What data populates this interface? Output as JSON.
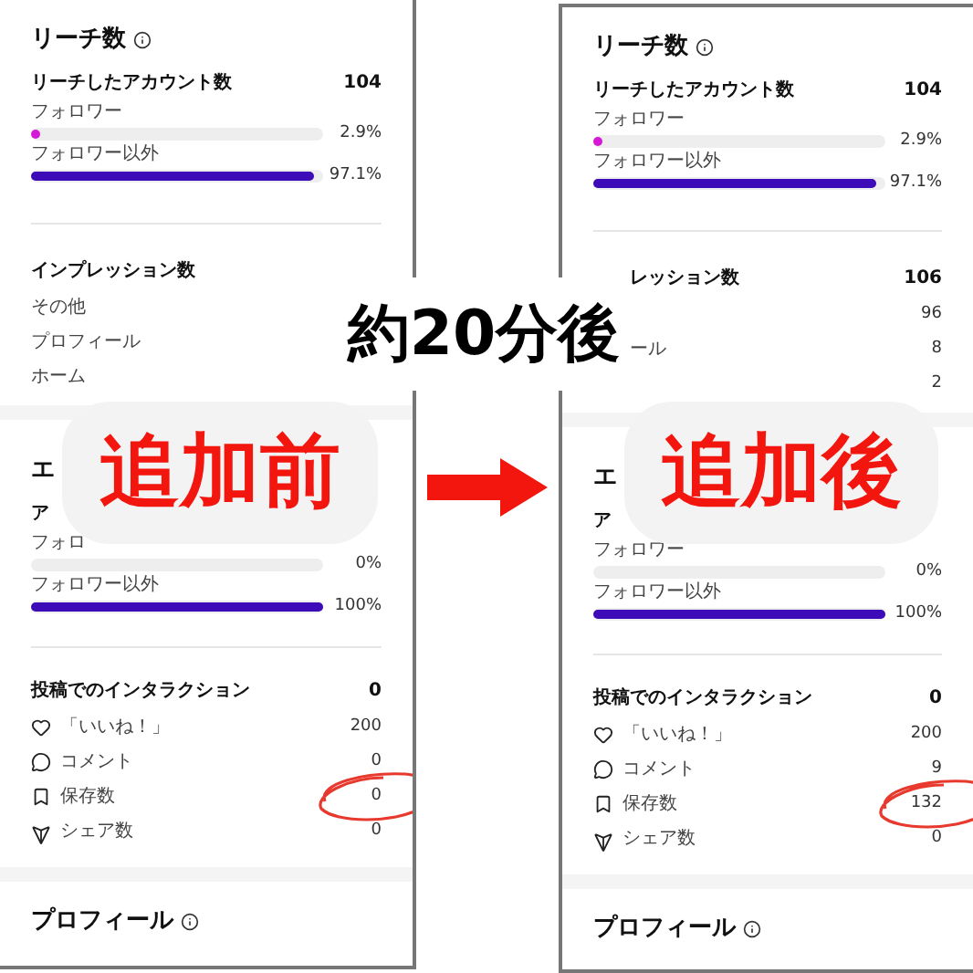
{
  "panels": [
    {
      "cards": [
        {
          "sections": [
            {
              "rows": [
                {
                  "kind": "title",
                  "label": "リーチ数",
                  "info": true
                },
                {
                  "kind": "stat",
                  "label": "リーチしたアカウント数",
                  "value": "104"
                },
                {
                  "kind": "bar",
                  "label": "フォロワー",
                  "level": 0.029,
                  "reading": "2.9%",
                  "color": "#d41ad4"
                },
                {
                  "kind": "bar",
                  "label": "フォロワー以外",
                  "level": 0.971,
                  "reading": "97.1%",
                  "color": "#3d0bb8"
                }
              ]
            },
            {
              "rows": [
                {
                  "kind": "stat",
                  "label": "インプレッション数"
                },
                {
                  "kind": "row",
                  "label": "その他"
                },
                {
                  "kind": "row",
                  "label": "プロフィール"
                },
                {
                  "kind": "row",
                  "label": "ホーム"
                }
              ]
            }
          ]
        },
        {
          "sections": [
            {
              "rows": [
                {
                  "kind": "title",
                  "label": "エ",
                  "info": false
                },
                {
                  "kind": "stat",
                  "label": "ア"
                },
                {
                  "kind": "bar",
                  "label": "フォロ",
                  "reading": "0%"
                },
                {
                  "kind": "bar",
                  "label": "フォロワー以外",
                  "level": 1,
                  "reading": "100%",
                  "color": "#3d0bb8"
                }
              ]
            },
            {
              "rows": [
                {
                  "kind": "stat",
                  "label": "投稿でのインタラクション",
                  "value": "0"
                },
                {
                  "kind": "likes",
                  "label": "「いいね！」",
                  "value": "200",
                  "circled": false
                },
                {
                  "kind": "comments",
                  "label": "コメント",
                  "value": "0",
                  "circled": false
                },
                {
                  "kind": "saves",
                  "label": "保存数",
                  "value": "0",
                  "circled": true
                },
                {
                  "kind": "shares",
                  "label": "シェア数",
                  "value": "0",
                  "circled": false
                }
              ]
            }
          ]
        },
        {
          "sections": [
            {
              "rows": [
                {
                  "kind": "title",
                  "label": "プロフィール",
                  "info": true
                }
              ]
            }
          ]
        }
      ]
    },
    {
      "cards": [
        {
          "sections": [
            {
              "rows": [
                {
                  "kind": "title",
                  "label": "リーチ数",
                  "info": true
                },
                {
                  "kind": "stat",
                  "label": "リーチしたアカウント数",
                  "value": "104"
                },
                {
                  "kind": "bar",
                  "label": "フォロワー",
                  "level": 0.029,
                  "reading": "2.9%",
                  "color": "#d41ad4"
                },
                {
                  "kind": "bar",
                  "label": "フォロワー以外",
                  "level": 0.971,
                  "reading": "97.1%",
                  "color": "#3d0bb8"
                }
              ]
            },
            {
              "rows": [
                {
                  "kind": "partstat",
                  "label": "レッション数",
                  "value": "106"
                },
                {
                  "kind": "partrow",
                  "value": "96"
                },
                {
                  "kind": "partrow",
                  "label": "ール",
                  "value": "8"
                },
                {
                  "kind": "partrow",
                  "value": "2"
                }
              ]
            }
          ]
        },
        {
          "sections": [
            {
              "rows": [
                {
                  "kind": "title",
                  "label": "エ",
                  "info": false
                },
                {
                  "kind": "stat",
                  "label": "ア"
                },
                {
                  "kind": "bar",
                  "label": "フォロワー",
                  "reading": "0%"
                },
                {
                  "kind": "bar",
                  "label": "フォロワー以外",
                  "level": 1,
                  "reading": "100%",
                  "color": "#3d0bb8"
                }
              ]
            },
            {
              "rows": [
                {
                  "kind": "stat",
                  "label": "投稿でのインタラクション",
                  "value": "0"
                },
                {
                  "kind": "likes",
                  "label": "「いいね！」",
                  "value": "200",
                  "circled": false
                },
                {
                  "kind": "comments",
                  "label": "コメント",
                  "value": "9",
                  "circled": false
                },
                {
                  "kind": "saves",
                  "label": "保存数",
                  "value": "132",
                  "circled": true
                },
                {
                  "kind": "shares",
                  "label": "シェア数",
                  "value": "0",
                  "circled": false
                }
              ]
            }
          ]
        },
        {
          "sections": [
            {
              "rows": [
                {
                  "kind": "title",
                  "label": "プロフィール",
                  "info": true
                }
              ]
            }
          ]
        }
      ]
    }
  ],
  "overlays": {
    "time_label": "約20分後",
    "before_label": "追加前",
    "after_label": "追加後"
  }
}
